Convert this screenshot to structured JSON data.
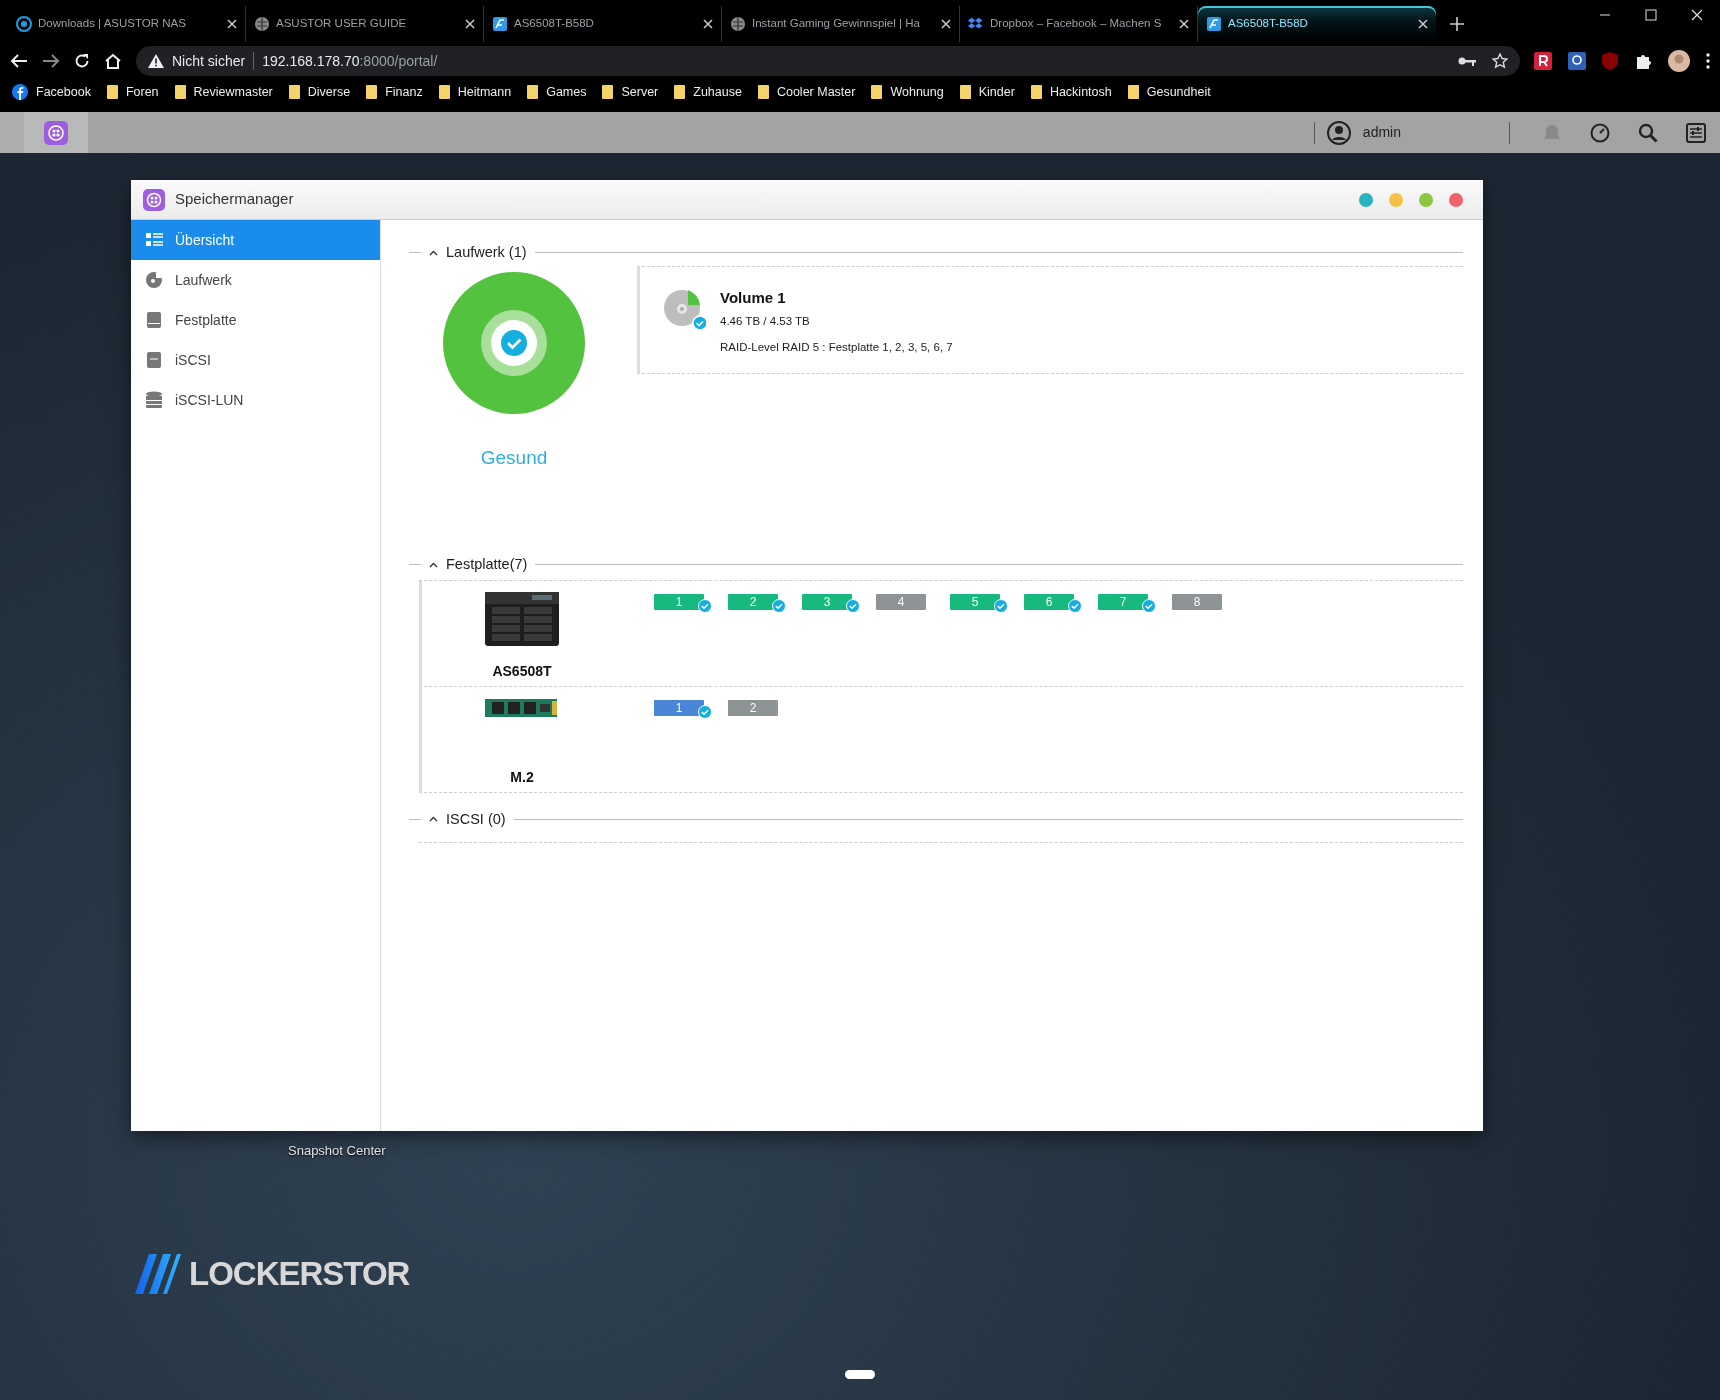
{
  "browser": {
    "tabs": [
      {
        "title": "Downloads | ASUSTOR NAS",
        "selected": false
      },
      {
        "title": "ASUSTOR USER GUIDE",
        "selected": false
      },
      {
        "title": "AS6508T-B58D",
        "selected": false
      },
      {
        "title": "Instant Gaming Gewinnspiel | Ha",
        "selected": false
      },
      {
        "title": "Dropbox – Facebook – Machen S",
        "selected": false
      },
      {
        "title": "AS6508T-B58D",
        "selected": true
      }
    ],
    "address": {
      "security": "Nicht sicher",
      "host": "192.168.178.70",
      "path": ":8000/portal/"
    },
    "bookmarks": [
      "Facebook",
      "Foren",
      "Reviewmaster",
      "Diverse",
      "Finanz",
      "Heitmann",
      "Games",
      "Server",
      "Zuhause",
      "Cooler Master",
      "Wohnung",
      "Kinder",
      "Hackintosh",
      "Gesundheit"
    ]
  },
  "nas_bar": {
    "user": "admin"
  },
  "window": {
    "title": "Speichermanager",
    "sidebar": [
      {
        "label": "Übersicht",
        "selected": true
      },
      {
        "label": "Laufwerk",
        "selected": false
      },
      {
        "label": "Festplatte",
        "selected": false
      },
      {
        "label": "iSCSI",
        "selected": false
      },
      {
        "label": "iSCSI-LUN",
        "selected": false
      }
    ],
    "volumes": {
      "heading": "Laufwerk (1)",
      "expanded": true,
      "status": "Gesund",
      "volume": {
        "name": "Volume 1",
        "usage": "4.46 TB / 4.53 TB",
        "raid": "RAID-Level RAID 5 : Festplatte 1, 2, 3, 5, 6, 7"
      }
    },
    "disks": {
      "heading": "Festplatte(7)",
      "expanded": true,
      "devices": [
        {
          "name": "AS6508T",
          "kind": "nas",
          "slots": [
            {
              "label": "1",
              "color": "#17b97e",
              "checked": true
            },
            {
              "label": "2",
              "color": "#17b97e",
              "checked": true
            },
            {
              "label": "3",
              "color": "#17b97e",
              "checked": true
            },
            {
              "label": "4",
              "color": "#8e9396",
              "checked": false
            },
            {
              "label": "5",
              "color": "#17b97e",
              "checked": true
            },
            {
              "label": "6",
              "color": "#17b97e",
              "checked": true
            },
            {
              "label": "7",
              "color": "#17b97e",
              "checked": true
            },
            {
              "label": "8",
              "color": "#8e9396",
              "checked": false
            }
          ]
        },
        {
          "name": "M.2",
          "kind": "m2",
          "slots": [
            {
              "label": "1",
              "color": "#4a86d8",
              "checked": true
            },
            {
              "label": "2",
              "color": "#8e9396",
              "checked": false
            }
          ]
        }
      ]
    },
    "iscsi": {
      "heading": "ISCSI (0)",
      "expanded": true
    }
  },
  "desktop": {
    "icon_label": "Snapshot Center",
    "logo": "LOCKERSTOR"
  }
}
